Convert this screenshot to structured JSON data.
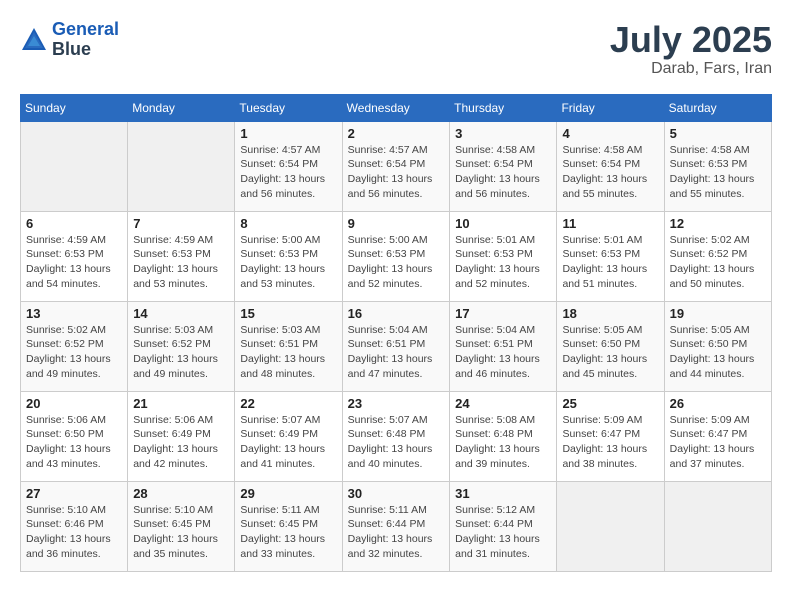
{
  "header": {
    "logo_line1": "General",
    "logo_line2": "Blue",
    "title": "July 2025",
    "subtitle": "Darab, Fars, Iran"
  },
  "weekdays": [
    "Sunday",
    "Monday",
    "Tuesday",
    "Wednesday",
    "Thursday",
    "Friday",
    "Saturday"
  ],
  "weeks": [
    [
      {
        "day": null
      },
      {
        "day": null
      },
      {
        "day": "1",
        "sunrise": "Sunrise: 4:57 AM",
        "sunset": "Sunset: 6:54 PM",
        "daylight": "Daylight: 13 hours and 56 minutes."
      },
      {
        "day": "2",
        "sunrise": "Sunrise: 4:57 AM",
        "sunset": "Sunset: 6:54 PM",
        "daylight": "Daylight: 13 hours and 56 minutes."
      },
      {
        "day": "3",
        "sunrise": "Sunrise: 4:58 AM",
        "sunset": "Sunset: 6:54 PM",
        "daylight": "Daylight: 13 hours and 56 minutes."
      },
      {
        "day": "4",
        "sunrise": "Sunrise: 4:58 AM",
        "sunset": "Sunset: 6:54 PM",
        "daylight": "Daylight: 13 hours and 55 minutes."
      },
      {
        "day": "5",
        "sunrise": "Sunrise: 4:58 AM",
        "sunset": "Sunset: 6:53 PM",
        "daylight": "Daylight: 13 hours and 55 minutes."
      }
    ],
    [
      {
        "day": "6",
        "sunrise": "Sunrise: 4:59 AM",
        "sunset": "Sunset: 6:53 PM",
        "daylight": "Daylight: 13 hours and 54 minutes."
      },
      {
        "day": "7",
        "sunrise": "Sunrise: 4:59 AM",
        "sunset": "Sunset: 6:53 PM",
        "daylight": "Daylight: 13 hours and 53 minutes."
      },
      {
        "day": "8",
        "sunrise": "Sunrise: 5:00 AM",
        "sunset": "Sunset: 6:53 PM",
        "daylight": "Daylight: 13 hours and 53 minutes."
      },
      {
        "day": "9",
        "sunrise": "Sunrise: 5:00 AM",
        "sunset": "Sunset: 6:53 PM",
        "daylight": "Daylight: 13 hours and 52 minutes."
      },
      {
        "day": "10",
        "sunrise": "Sunrise: 5:01 AM",
        "sunset": "Sunset: 6:53 PM",
        "daylight": "Daylight: 13 hours and 52 minutes."
      },
      {
        "day": "11",
        "sunrise": "Sunrise: 5:01 AM",
        "sunset": "Sunset: 6:53 PM",
        "daylight": "Daylight: 13 hours and 51 minutes."
      },
      {
        "day": "12",
        "sunrise": "Sunrise: 5:02 AM",
        "sunset": "Sunset: 6:52 PM",
        "daylight": "Daylight: 13 hours and 50 minutes."
      }
    ],
    [
      {
        "day": "13",
        "sunrise": "Sunrise: 5:02 AM",
        "sunset": "Sunset: 6:52 PM",
        "daylight": "Daylight: 13 hours and 49 minutes."
      },
      {
        "day": "14",
        "sunrise": "Sunrise: 5:03 AM",
        "sunset": "Sunset: 6:52 PM",
        "daylight": "Daylight: 13 hours and 49 minutes."
      },
      {
        "day": "15",
        "sunrise": "Sunrise: 5:03 AM",
        "sunset": "Sunset: 6:51 PM",
        "daylight": "Daylight: 13 hours and 48 minutes."
      },
      {
        "day": "16",
        "sunrise": "Sunrise: 5:04 AM",
        "sunset": "Sunset: 6:51 PM",
        "daylight": "Daylight: 13 hours and 47 minutes."
      },
      {
        "day": "17",
        "sunrise": "Sunrise: 5:04 AM",
        "sunset": "Sunset: 6:51 PM",
        "daylight": "Daylight: 13 hours and 46 minutes."
      },
      {
        "day": "18",
        "sunrise": "Sunrise: 5:05 AM",
        "sunset": "Sunset: 6:50 PM",
        "daylight": "Daylight: 13 hours and 45 minutes."
      },
      {
        "day": "19",
        "sunrise": "Sunrise: 5:05 AM",
        "sunset": "Sunset: 6:50 PM",
        "daylight": "Daylight: 13 hours and 44 minutes."
      }
    ],
    [
      {
        "day": "20",
        "sunrise": "Sunrise: 5:06 AM",
        "sunset": "Sunset: 6:50 PM",
        "daylight": "Daylight: 13 hours and 43 minutes."
      },
      {
        "day": "21",
        "sunrise": "Sunrise: 5:06 AM",
        "sunset": "Sunset: 6:49 PM",
        "daylight": "Daylight: 13 hours and 42 minutes."
      },
      {
        "day": "22",
        "sunrise": "Sunrise: 5:07 AM",
        "sunset": "Sunset: 6:49 PM",
        "daylight": "Daylight: 13 hours and 41 minutes."
      },
      {
        "day": "23",
        "sunrise": "Sunrise: 5:07 AM",
        "sunset": "Sunset: 6:48 PM",
        "daylight": "Daylight: 13 hours and 40 minutes."
      },
      {
        "day": "24",
        "sunrise": "Sunrise: 5:08 AM",
        "sunset": "Sunset: 6:48 PM",
        "daylight": "Daylight: 13 hours and 39 minutes."
      },
      {
        "day": "25",
        "sunrise": "Sunrise: 5:09 AM",
        "sunset": "Sunset: 6:47 PM",
        "daylight": "Daylight: 13 hours and 38 minutes."
      },
      {
        "day": "26",
        "sunrise": "Sunrise: 5:09 AM",
        "sunset": "Sunset: 6:47 PM",
        "daylight": "Daylight: 13 hours and 37 minutes."
      }
    ],
    [
      {
        "day": "27",
        "sunrise": "Sunrise: 5:10 AM",
        "sunset": "Sunset: 6:46 PM",
        "daylight": "Daylight: 13 hours and 36 minutes."
      },
      {
        "day": "28",
        "sunrise": "Sunrise: 5:10 AM",
        "sunset": "Sunset: 6:45 PM",
        "daylight": "Daylight: 13 hours and 35 minutes."
      },
      {
        "day": "29",
        "sunrise": "Sunrise: 5:11 AM",
        "sunset": "Sunset: 6:45 PM",
        "daylight": "Daylight: 13 hours and 33 minutes."
      },
      {
        "day": "30",
        "sunrise": "Sunrise: 5:11 AM",
        "sunset": "Sunset: 6:44 PM",
        "daylight": "Daylight: 13 hours and 32 minutes."
      },
      {
        "day": "31",
        "sunrise": "Sunrise: 5:12 AM",
        "sunset": "Sunset: 6:44 PM",
        "daylight": "Daylight: 13 hours and 31 minutes."
      },
      {
        "day": null
      },
      {
        "day": null
      }
    ]
  ]
}
